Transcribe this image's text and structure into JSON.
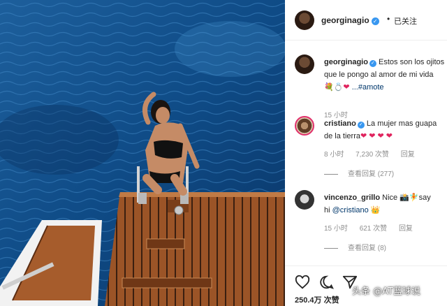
{
  "header": {
    "username": "georginagio",
    "separator": "•",
    "follow_status": "已关注"
  },
  "caption": {
    "username": "georginagio",
    "line1": "Estos son los ojitos",
    "line2": "que le pongo al amor de mi vida",
    "line3_hashtag": "...#amote",
    "time": "15 小时"
  },
  "comments": [
    {
      "username": "cristiano",
      "line1": "La mujer mas guapa",
      "line2": "de la tierra",
      "time": "8 小时",
      "likes": "7,230 次赞",
      "reply": "回复",
      "view_replies": "查看回复 (277)"
    },
    {
      "username": "vincenzo_grillo",
      "line1": "Nice",
      "line1_tail": "say",
      "line2_prefix": "hi",
      "line2_mention": "@cristiano",
      "time": "15 小时",
      "likes": "621 次赞",
      "reply": "回复",
      "view_replies": "查看回复 (8)"
    }
  ],
  "actions": {
    "like_icon": "heart-outline-icon",
    "comment_icon": "comment-bubble-icon",
    "share_icon": "paper-plane-icon",
    "likes_count": "250.4万 次赞"
  },
  "watermark": "头条 @AT蓝球说",
  "colors": {
    "verified": "#3897f0",
    "link": "#00376b",
    "meta": "#8e8e8e",
    "heart": "#e0245e"
  }
}
